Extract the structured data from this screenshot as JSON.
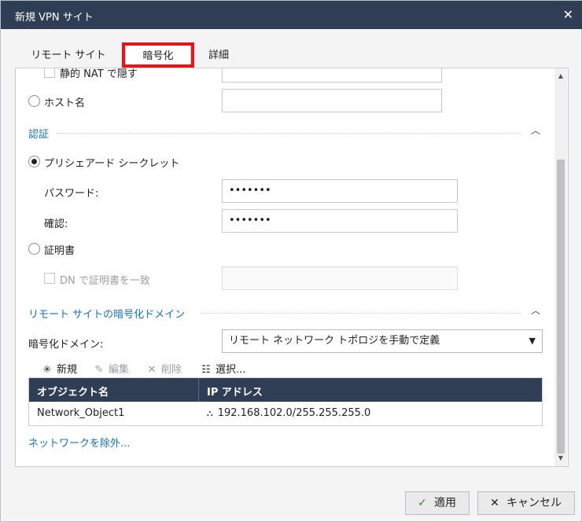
{
  "window": {
    "title": "新規 VPN サイト",
    "close_glyph": "✕"
  },
  "tabs": [
    {
      "label": "リモート サイト"
    },
    {
      "label": "暗号化"
    },
    {
      "label": "詳細"
    }
  ],
  "form": {
    "static_nat_label": "静的 NAT で隠す",
    "hostname_label": "ホスト名",
    "hostname_value": ""
  },
  "auth": {
    "section_title": "認証",
    "psk_label": "プリシェアード シークレット",
    "password_label": "パスワード:",
    "password_value": "•••••••",
    "confirm_label": "確認:",
    "confirm_value": "•••••••",
    "cert_label": "証明書",
    "dn_match_label": "DN で証明書を一致",
    "dn_value": ""
  },
  "domain": {
    "section_title": "リモート サイトの暗号化ドメイン",
    "domain_label": "暗号化ドメイン:",
    "domain_selected": "リモート ネットワーク トポロジを手動で定義",
    "toolbar": {
      "new_label": "新規",
      "edit_label": "編集",
      "delete_label": "削除",
      "select_label": "選択..."
    },
    "table": {
      "headers": [
        "オブジェクト名",
        "IP アドレス"
      ],
      "rows": [
        {
          "name": "Network_Object1",
          "ip": "192.168.102.0/255.255.255.0"
        }
      ]
    },
    "exclude_link": "ネットワークを除外..."
  },
  "footer": {
    "apply_label": "適用",
    "cancel_label": "キャンセル"
  },
  "colors": {
    "titlebar": "#2f3e55",
    "link": "#1a6fb5",
    "highlight": "#e8141c"
  }
}
